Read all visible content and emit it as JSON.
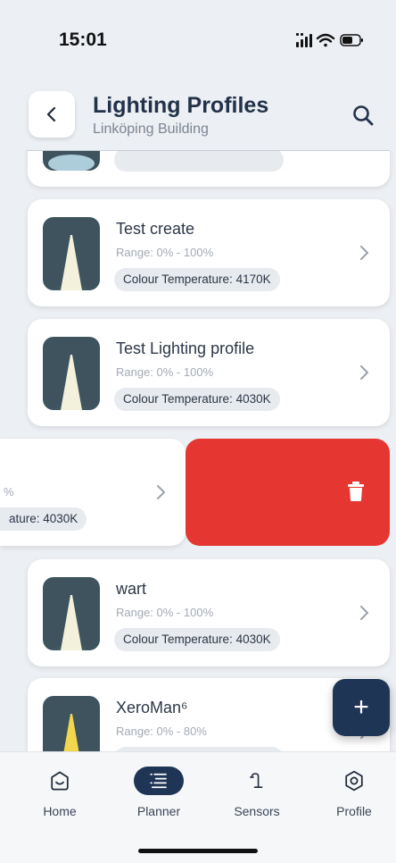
{
  "status_bar": {
    "time": "15:01"
  },
  "header": {
    "title": "Lighting Profiles",
    "subtitle": "Linköping Building"
  },
  "profiles": [
    {
      "name": "Test create",
      "range": "Range: 0% - 100%",
      "colour_temperature": "Colour Temperature: 4170K",
      "light": "white"
    },
    {
      "name": "Test Lighting profile",
      "range": "Range: 0% - 100%",
      "colour_temperature": "Colour Temperature: 4030K",
      "light": "white"
    },
    {
      "name": "",
      "range": "%",
      "colour_temperature": "ature: 4030K",
      "light": "white"
    },
    {
      "name": "wart",
      "range": "Range: 0% - 100%",
      "colour_temperature": "Colour Temperature: 4030K",
      "light": "white"
    },
    {
      "name": "XeroMan⁶",
      "range": "Range: 0% - 80%",
      "colour_temperature": "",
      "light": "yellow"
    }
  ],
  "fab": {
    "label": "+"
  },
  "tabs": [
    {
      "label": "Home",
      "icon": "home-icon"
    },
    {
      "label": "Planner",
      "icon": "planner-icon",
      "active": true
    },
    {
      "label": "Sensors",
      "icon": "sensors-icon"
    },
    {
      "label": "Profile",
      "icon": "profile-icon"
    }
  ],
  "colors": {
    "accent": "#1f3556",
    "delete": "#e63631",
    "background": "#eceff3"
  }
}
